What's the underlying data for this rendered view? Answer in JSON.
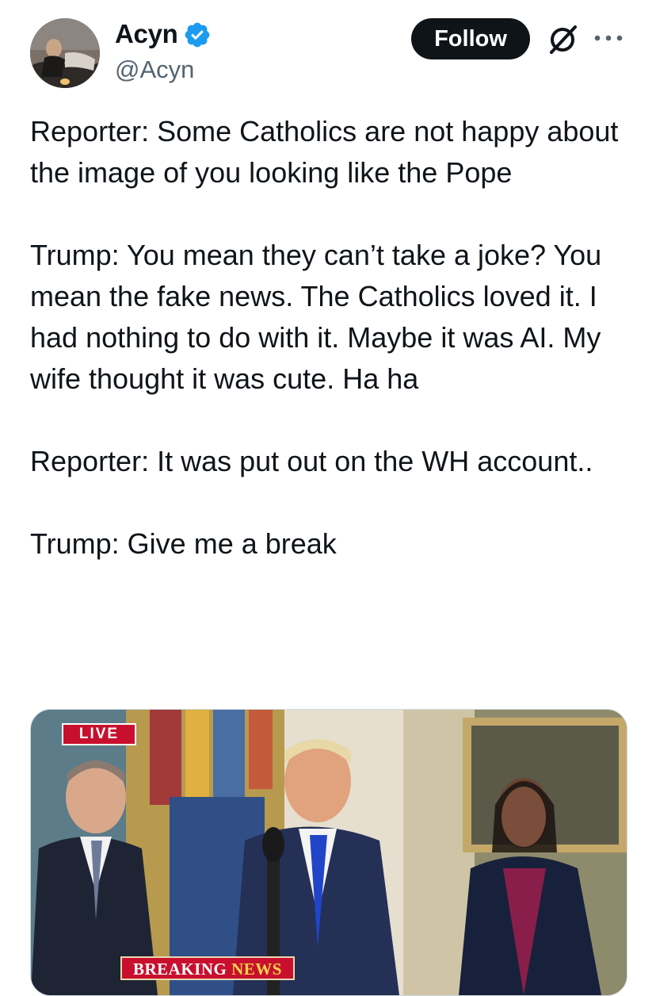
{
  "author": {
    "display_name": "Acyn",
    "handle": "@Acyn",
    "verified_color": "#1d9bf0",
    "avatar_icon": "profile-photo"
  },
  "actions": {
    "follow_label": "Follow",
    "grok_icon": "grok-icon",
    "more_icon": "more-horizontal-icon"
  },
  "tweet": {
    "paragraphs": [
      "Reporter: Some Catholics are not happy about the image of you looking like the Pope",
      "Trump: You mean they can’t take a joke? You mean the fake news. The Catholics loved it. I had nothing to do with it. Maybe it was AI. My wife thought it was cute. Ha ha",
      "Reporter: It was put out on the WH account..",
      "Trump: Give me a break"
    ]
  },
  "media": {
    "live_label": "LIVE",
    "breaking_label": "BREAKING",
    "news_label": "NEWS"
  },
  "colors": {
    "text": "#0f1419",
    "secondary": "#536471",
    "live_red": "#c8102e"
  }
}
